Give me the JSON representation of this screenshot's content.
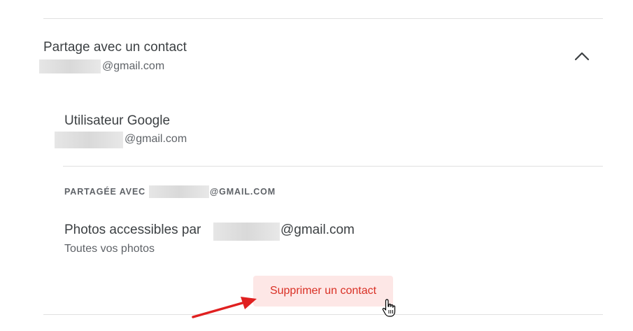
{
  "section": {
    "title": "Partage avec un contact",
    "email_suffix": "@gmail.com"
  },
  "user": {
    "name": "Utilisateur Google",
    "email_suffix": "@gmail.com"
  },
  "shared_with": {
    "label": "PARTAGÉE AVEC",
    "email_suffix": "@GMAIL.COM"
  },
  "photos": {
    "title_prefix": "Photos accessibles par",
    "email_suffix": "@gmail.com",
    "subtitle": "Toutes vos photos"
  },
  "remove_button": {
    "label": "Supprimer un contact"
  },
  "icons": {
    "collapse": "chevron-up-icon",
    "cursor": "hand-pointer-icon",
    "annotation": "red-arrow"
  },
  "colors": {
    "button_bg": "#fde7e6",
    "button_text": "#d93025",
    "annotation_arrow": "#e02020"
  }
}
